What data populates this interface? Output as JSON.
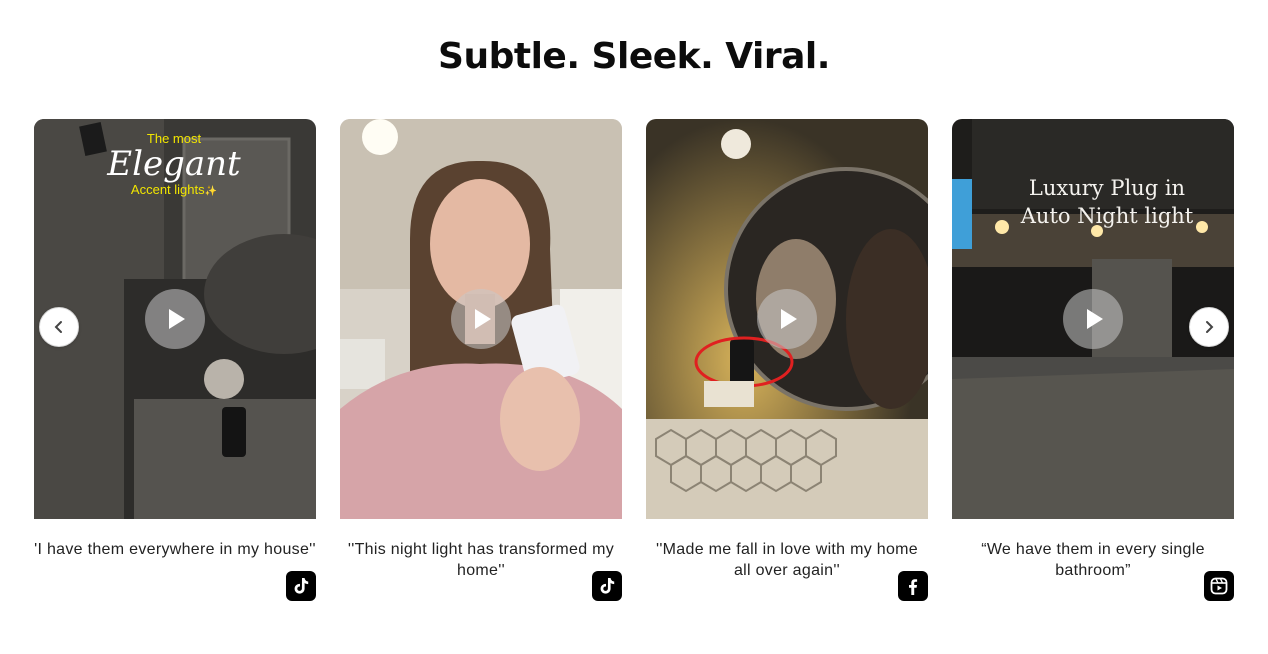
{
  "heading": "Subtle. Sleek. Viral.",
  "carousel": {
    "prev_icon": "chevron-left-icon",
    "next_icon": "chevron-right-icon"
  },
  "videos": [
    {
      "overlay": {
        "line1": "The most",
        "line2": "Elegant",
        "line3": "Accent lights",
        "sparkle": "✨"
      },
      "caption": "'I have them everywhere in my house''",
      "platform_icon": "tiktok-icon"
    },
    {
      "caption": "''This night light has transformed my home''",
      "platform_icon": "tiktok-icon"
    },
    {
      "caption": "''Made me fall in love with my home all over again''",
      "platform_icon": "facebook-icon"
    },
    {
      "overlay": {
        "line1": "Luxury Plug in",
        "line2": "Auto Night light"
      },
      "caption": "“We have them in every single bathroom”",
      "platform_icon": "instagram-reels-icon"
    }
  ],
  "colors": {
    "overlay_yellow": "#f2e600",
    "play_bg": "rgba(200,200,200,0.55)"
  }
}
